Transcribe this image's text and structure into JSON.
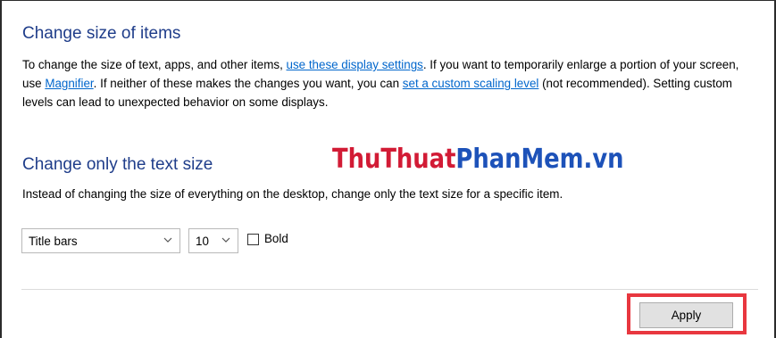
{
  "section1": {
    "heading": "Change size of items",
    "text_1": "To change the size of text, apps, and other items, ",
    "link_display_settings": "use these display settings",
    "text_2": ".  If you want to temporarily enlarge a portion of your screen, use ",
    "link_magnifier": "Magnifier",
    "text_3": ".  If neither of these makes the changes you want, you can ",
    "link_custom_scaling": "set a custom scaling level",
    "text_4": " (not recommended).  Setting custom levels can lead to unexpected behavior on some displays."
  },
  "section2": {
    "heading": "Change only the text size",
    "description": "Instead of changing the size of everything on the desktop, change only the text size for a specific item.",
    "item_select_value": "Title bars",
    "size_select_value": "10",
    "bold_label": "Bold",
    "bold_checked": false
  },
  "watermark": {
    "part1": "ThuThuat",
    "part2": "PhanMem.vn",
    "color_red": "#d21b35",
    "color_blue": "#1d52b9"
  },
  "apply_button": {
    "label": "Apply",
    "highlight_color": "#e8373f"
  },
  "icons": [
    "chevron-down-icon"
  ]
}
